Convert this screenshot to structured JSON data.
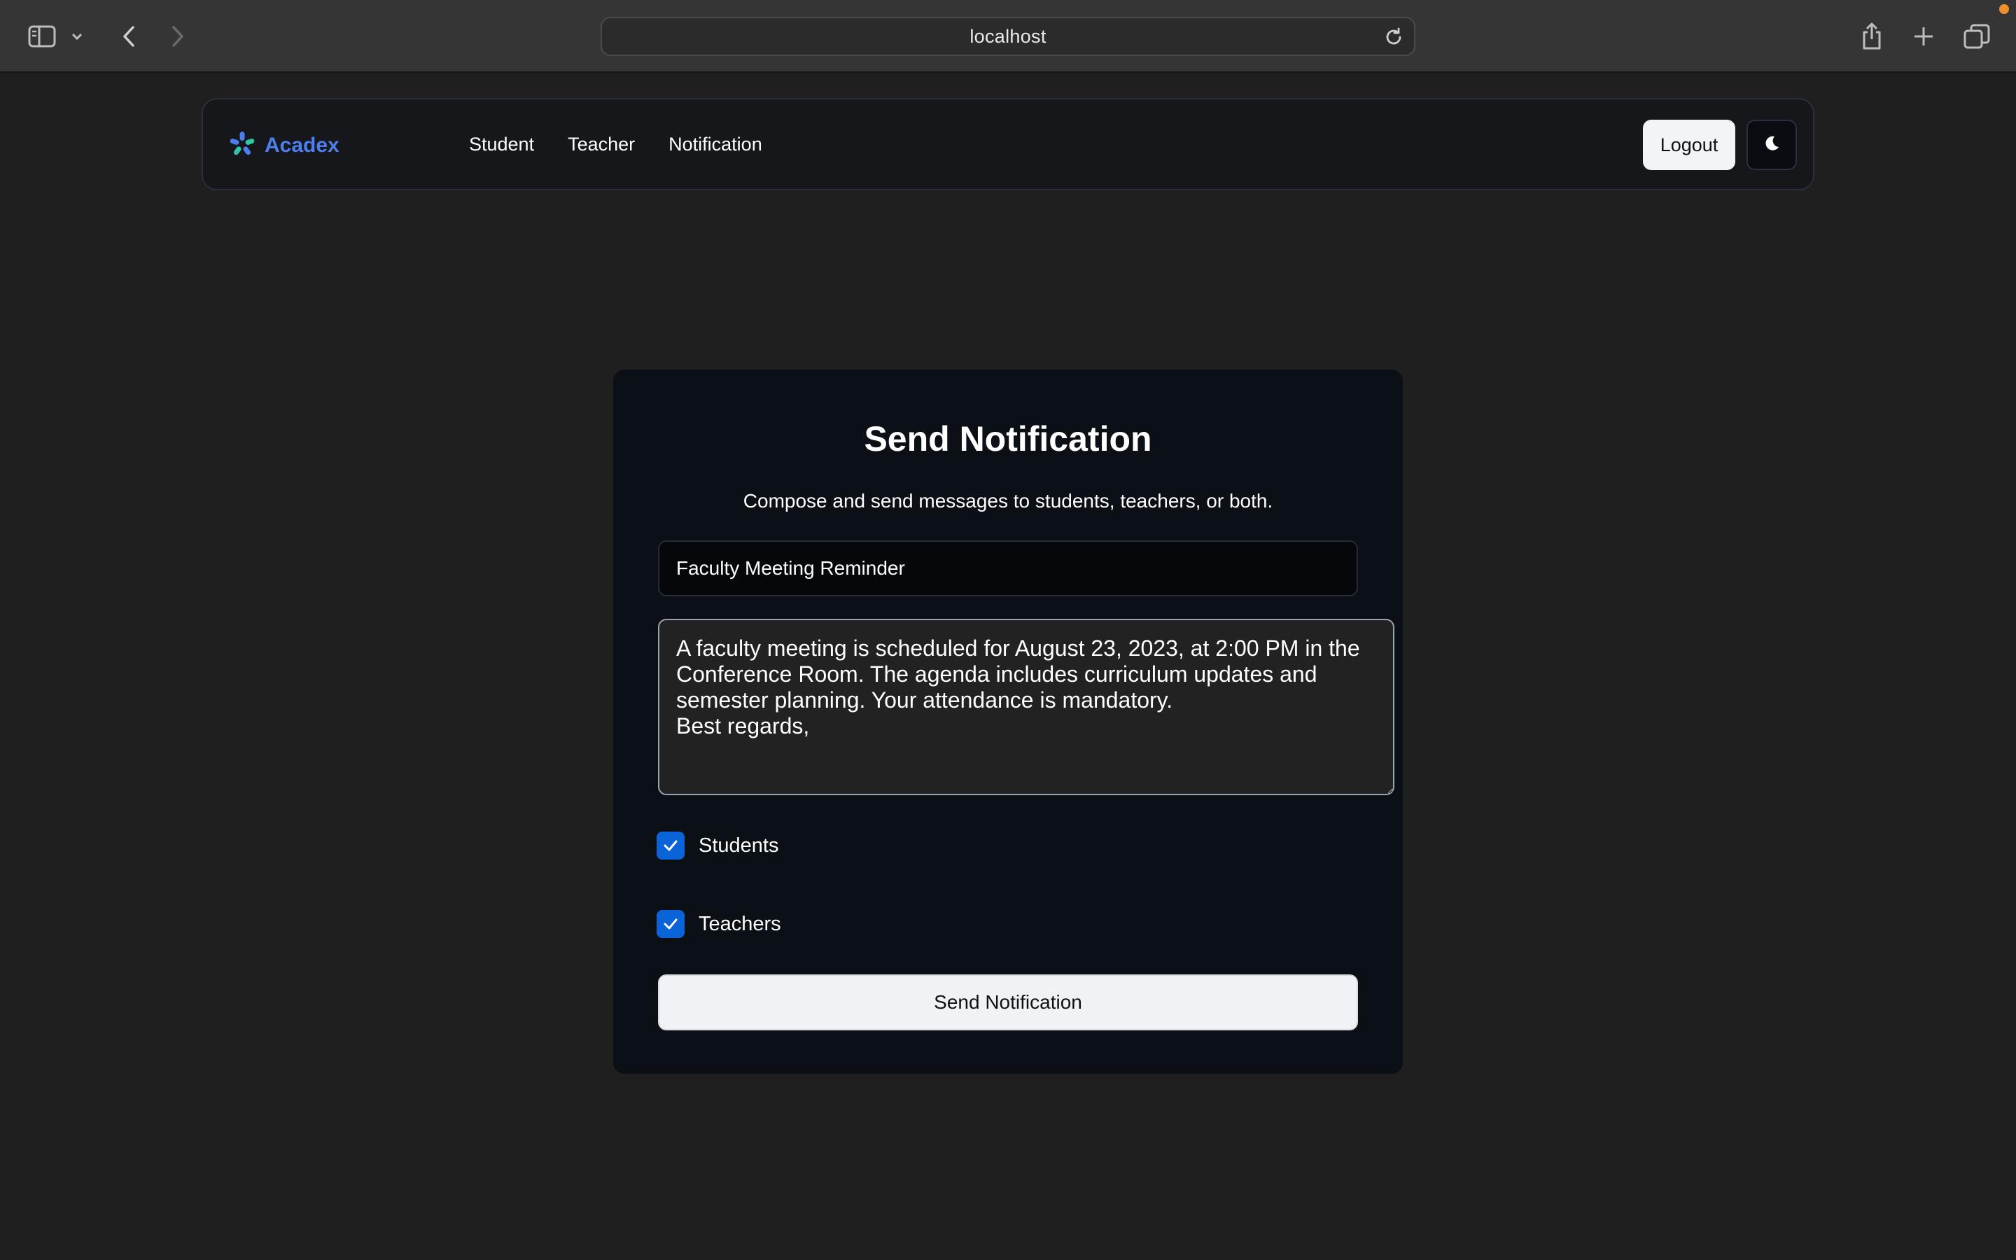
{
  "browser": {
    "url": "localhost",
    "icons": [
      "sidebar-icon",
      "chevron-down-icon",
      "back-icon",
      "forward-icon",
      "reload-icon",
      "share-icon",
      "new-tab-icon",
      "tabs-overview-icon"
    ]
  },
  "navbar": {
    "brand": "Acadex",
    "links": [
      "Student",
      "Teacher",
      "Notification"
    ],
    "logout_label": "Logout",
    "theme_icon": "moon-icon"
  },
  "form": {
    "title": "Send Notification",
    "subtitle": "Compose and send messages to students, teachers, or both.",
    "subject_value": "Faculty Meeting Reminder",
    "message_value": "A faculty meeting is scheduled for August 23, 2023, at 2:00 PM in the Conference Room. The agenda includes curriculum updates and semester planning. Your attendance is mandatory.\nBest regards,",
    "recipients": [
      {
        "label": "Students",
        "checked": true
      },
      {
        "label": "Teachers",
        "checked": true
      }
    ],
    "submit_label": "Send Notification"
  },
  "colors": {
    "background": "#1f1f1f",
    "card": "#0b0f16",
    "brand": "#4c7ef0",
    "checkbox": "#0a64d8"
  }
}
